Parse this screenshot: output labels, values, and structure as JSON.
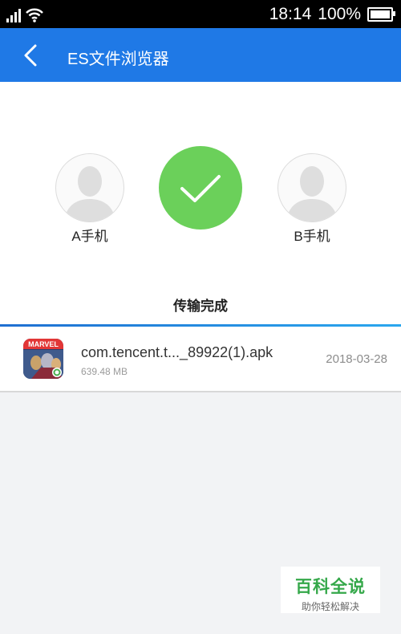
{
  "status_bar": {
    "time": "18:14",
    "battery": "100%",
    "icons": [
      "signal-icon",
      "wifi-icon",
      "battery-icon"
    ]
  },
  "app_bar": {
    "title": "ES文件浏览器",
    "back_icon": "chevron-left-icon",
    "background": "#1f79e6"
  },
  "transfer": {
    "sender_label": "A手机",
    "receiver_label": "B手机",
    "status_text": "传输完成",
    "status_icon": "checkmark-icon",
    "status_color": "#6bd05a"
  },
  "files": [
    {
      "name": "com.tencent.t..._89922(1).apk",
      "size": "639.48 MB",
      "date": "2018-03-28",
      "icon_text": "MARVEL"
    }
  ],
  "watermark": {
    "title": "百科全说",
    "subtitle": "助你轻松解决"
  }
}
